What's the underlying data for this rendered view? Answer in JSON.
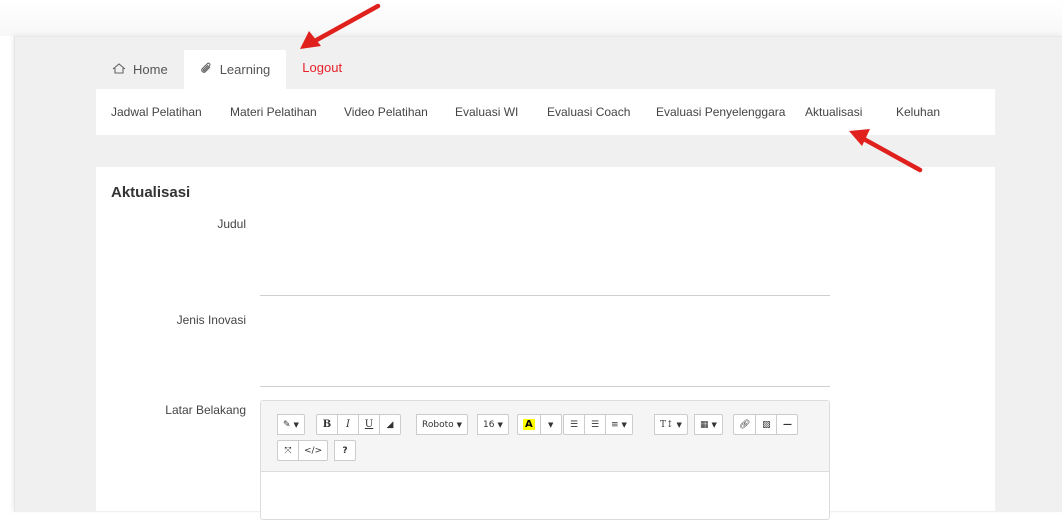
{
  "nav": {
    "tabs": [
      {
        "label": "Home",
        "icon": "home-icon"
      },
      {
        "label": "Learning",
        "icon": "paperclip-icon"
      },
      {
        "label": "Logout"
      }
    ],
    "active_tab": "Learning",
    "logout_color": "#e8202a"
  },
  "subnav": {
    "items": [
      "Jadwal Pelatihan",
      "Materi Pelatihan",
      "Video Pelatihan",
      "Evaluasi WI",
      "Evaluasi Coach",
      "Evaluasi Penyelenggara",
      "Aktualisasi",
      "Keluhan"
    ]
  },
  "page": {
    "title": "Aktualisasi",
    "fields": {
      "judul": "Judul",
      "jenis_inovasi": "Jenis Inovasi",
      "latar_belakang": "Latar Belakang"
    }
  },
  "editor": {
    "font_name": "Roboto",
    "font_size": "16",
    "color_letter": "A",
    "help": "?",
    "icons": [
      "magic-icon",
      "bold-icon",
      "italic-icon",
      "underline-icon",
      "eraser-icon",
      "font-color-icon",
      "unordered-list-icon",
      "ordered-list-icon",
      "align-icon",
      "line-height-icon",
      "table-icon",
      "link-icon",
      "image-icon",
      "hr-icon",
      "fullscreen-icon",
      "code-view-icon",
      "help-icon"
    ]
  },
  "colors": {
    "annotation_arrow": "#e0201c",
    "highlight": "#ffff00"
  }
}
